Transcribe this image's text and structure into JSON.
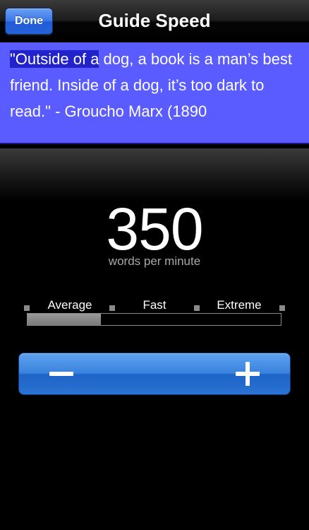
{
  "navbar": {
    "done_label": "Done",
    "title": "Guide Speed"
  },
  "preview": {
    "highlighted": "\"Outside of a",
    "rest": " dog, a book is a man’s best friend. Inside of a dog, it’s too dark to read.\" - Groucho Marx (1890"
  },
  "speed": {
    "value": "350",
    "unit": "words per minute",
    "level_fraction": 0.29
  },
  "levels": [
    "Average",
    "Fast",
    "Extreme"
  ],
  "stepper": {
    "decrease_icon": "minus-icon",
    "increase_icon": "plus-icon"
  },
  "colors": {
    "preview_bg": "#5a5cff",
    "highlight": "#2222cc",
    "button_blue": "#3a82de"
  }
}
